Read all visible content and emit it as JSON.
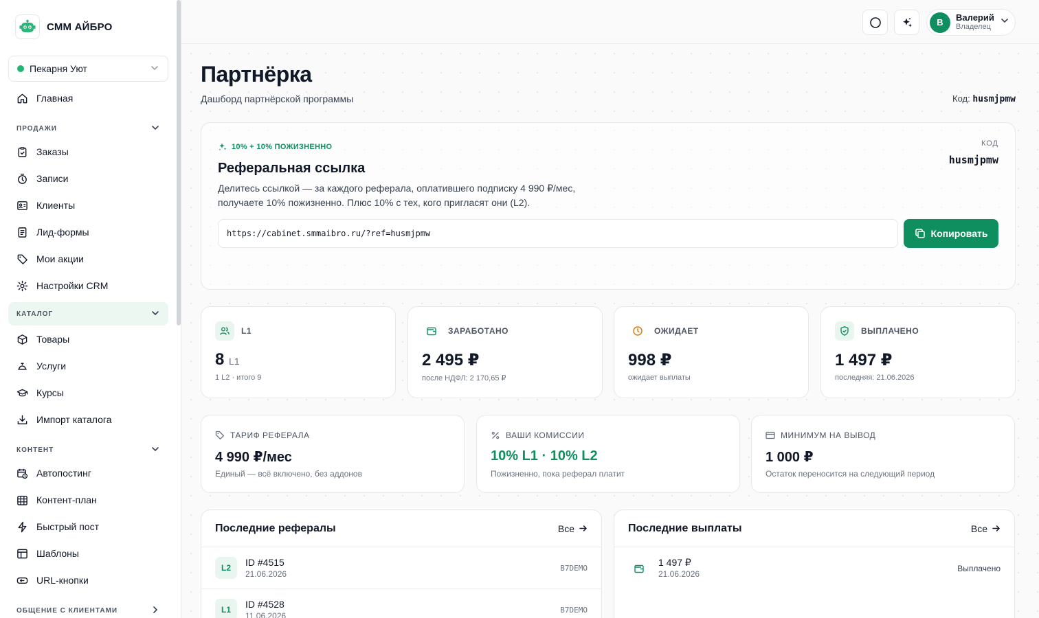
{
  "app": {
    "title": "СММ АЙБРО"
  },
  "workspace": {
    "name": "Пекарня Уют"
  },
  "sidebar": {
    "home": "Главная",
    "sections": [
      {
        "label": "ПРОДАЖИ",
        "items": [
          "Заказы",
          "Записи",
          "Клиенты",
          "Лид-формы",
          "Мои акции",
          "Настройки CRM"
        ]
      },
      {
        "label": "КАТАЛОГ",
        "items": [
          "Товары",
          "Услуги",
          "Курсы",
          "Импорт каталога"
        ]
      },
      {
        "label": "КОНТЕНТ",
        "items": [
          "Автопостинг",
          "Контент-план",
          "Быстрый пост",
          "Шаблоны",
          "URL-кнопки"
        ]
      },
      {
        "label": "ОБЩЕНИЕ С КЛИЕНТАМИ",
        "items": []
      }
    ]
  },
  "user": {
    "initial": "В",
    "name": "Валерий",
    "role": "Владелец"
  },
  "page": {
    "title": "Партнёрка",
    "subtitle": "Дашборд партнёрской программы",
    "code_label": "Код:",
    "code": "husmjpmw"
  },
  "referral": {
    "badge": "10% + 10% ПОЖИЗНЕННО",
    "title": "Реферальная ссылка",
    "desc_line1": "Делитесь ссылкой — за каждого реферала, оплатившего подписку 4 990 ₽/мес,",
    "desc_line2": "получаете 10% пожизненно. Плюс 10% с тех, кого пригласят они (L2).",
    "code_label": "КОД",
    "code": "husmjpmw",
    "link": "https://cabinet.smmaibro.ru/?ref=husmjpmw",
    "copy_label": "Копировать"
  },
  "stats": [
    {
      "label": "L1",
      "value": "8",
      "unit": "L1",
      "sub": "1 L2 · итого 9"
    },
    {
      "label": "ЗАРАБОТАНО",
      "value": "2 495 ₽",
      "unit": "",
      "sub": "после НДФЛ: 2 170,65 ₽"
    },
    {
      "label": "ОЖИДАЕТ",
      "value": "998 ₽",
      "unit": "",
      "sub": "ожидает выплаты"
    },
    {
      "label": "ВЫПЛАЧЕНО",
      "value": "1 497 ₽",
      "unit": "",
      "sub": "последняя: 21.06.2026"
    }
  ],
  "info": [
    {
      "label": "ТАРИФ РЕФЕРАЛА",
      "value": "4 990 ₽/мес",
      "sub": "Единый — всё включено, без аддонов"
    },
    {
      "label": "ВАШИ КОМИССИИ",
      "value": "10% L1 · 10% L2",
      "sub": "Пожизненно, пока реферал платит"
    },
    {
      "label": "МИНИМУМ НА ВЫВОД",
      "value": "1 000 ₽",
      "sub": "Остаток переносится на следующий период"
    }
  ],
  "referrals": {
    "title": "Последние рефералы",
    "all": "Все",
    "rows": [
      {
        "level": "L2",
        "id": "ID #4515",
        "date": "21.06.2026",
        "tag": "B7DEMO"
      },
      {
        "level": "L1",
        "id": "ID #4528",
        "date": "11.06.2026",
        "tag": "B7DEMO"
      }
    ]
  },
  "payouts": {
    "title": "Последние выплаты",
    "all": "Все",
    "rows": [
      {
        "amount": "1 497 ₽",
        "date": "21.06.2026",
        "status": "Выплачено"
      }
    ]
  },
  "colors": {
    "accent": "#0f8f5f",
    "accent_light": "#e8f6ef",
    "warning": "#d97706"
  }
}
